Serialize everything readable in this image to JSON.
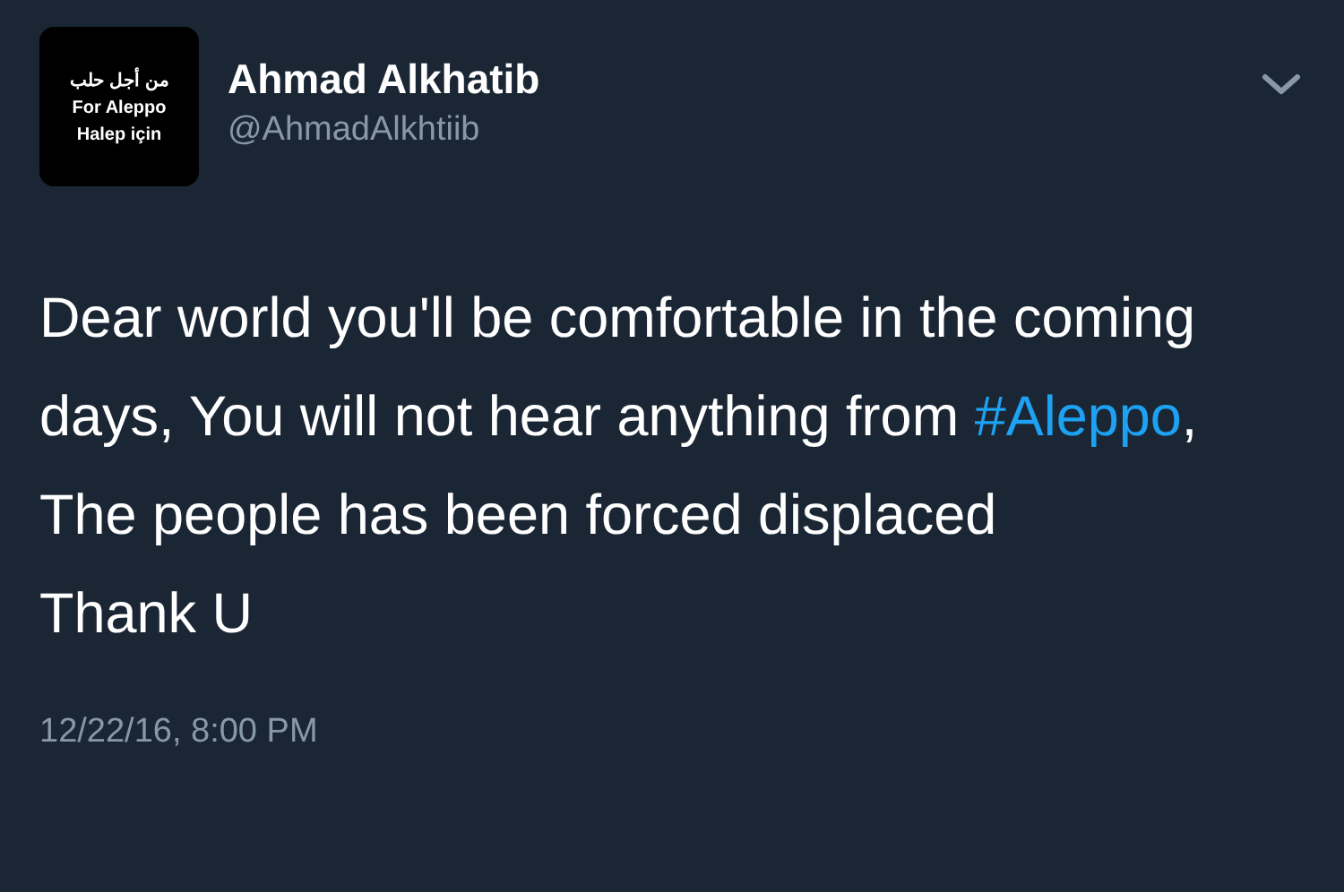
{
  "avatar": {
    "lines": [
      "من أجل حلب",
      "For Aleppo",
      "Halep için"
    ]
  },
  "author": {
    "name": "Ahmad Alkhatib",
    "handle": "@AhmadAlkhtiib"
  },
  "tweet": {
    "text_before": "Dear world you'll be comfortable in the coming days, You will not hear anything from ",
    "hashtag": "#Aleppo",
    "text_after": ", The people has been forced displaced\nThank U"
  },
  "timestamp": "12/22/16, 8:00 PM"
}
